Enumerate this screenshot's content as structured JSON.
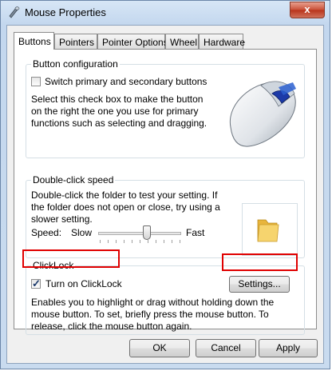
{
  "window": {
    "title": "Mouse Properties",
    "close_glyph": "x"
  },
  "tabs": [
    {
      "label": "Buttons",
      "active": true
    },
    {
      "label": "Pointers",
      "active": false
    },
    {
      "label": "Pointer Options",
      "active": false
    },
    {
      "label": "Wheel",
      "active": false
    },
    {
      "label": "Hardware",
      "active": false
    }
  ],
  "button_config": {
    "legend": "Button configuration",
    "switch_label": "Switch primary and secondary buttons",
    "switch_checked": false,
    "description": "Select this check box to make the button on the right the one you use for primary functions such as selecting and dragging."
  },
  "double_click": {
    "legend": "Double-click speed",
    "description": "Double-click the folder to test your setting. If the folder does not open or close, try using a slower setting.",
    "speed_label": "Speed:",
    "slow_label": "Slow",
    "fast_label": "Fast",
    "speed_fraction": 0.6
  },
  "clicklock": {
    "legend": "ClickLock",
    "checkbox_label": "Turn on ClickLock",
    "checked": true,
    "settings_label": "Settings...",
    "description": "Enables you to highlight or drag without holding down the mouse button. To set, briefly press the mouse button. To release, click the mouse button again."
  },
  "footer": {
    "ok_label": "OK",
    "cancel_label": "Cancel",
    "apply_label": "Apply"
  },
  "colors": {
    "highlight": "#e00000",
    "accent": "#2a5fd0",
    "folder": "#f2c94c"
  }
}
